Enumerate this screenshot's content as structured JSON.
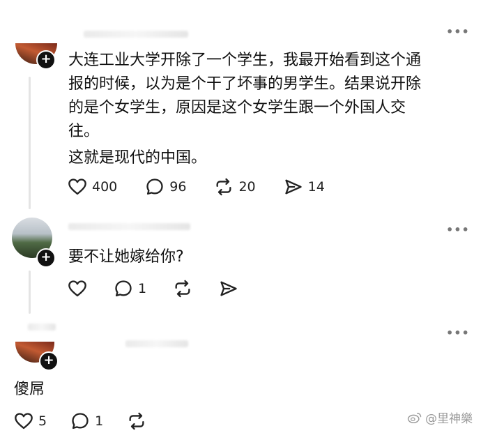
{
  "posts": [
    {
      "lines": [
        "大连工业大学开除了一个学生，我最开始看到这个通",
        "报的时候，以为是个干了坏事的男学生。结果说开除",
        "的是个女学生，原因是这个女学生跟一个外国人交",
        "往。"
      ],
      "second_paragraph": "这就是现代的中国。",
      "likes": "400",
      "comments": "96",
      "reposts": "20",
      "shares": "14"
    },
    {
      "text": "要不让她嫁给你?",
      "comments": "1"
    },
    {
      "text": "傻屌",
      "likes": "5",
      "comments": "1"
    }
  ],
  "follow_symbol": "+",
  "more_symbol": "•••",
  "watermark": {
    "text": "@里神樂",
    "icon": "weibo-icon"
  },
  "colors": {
    "text": "#111111",
    "icon": "#222222",
    "thread_line": "#e4e4e4",
    "watermark": "#9a9a9a"
  }
}
